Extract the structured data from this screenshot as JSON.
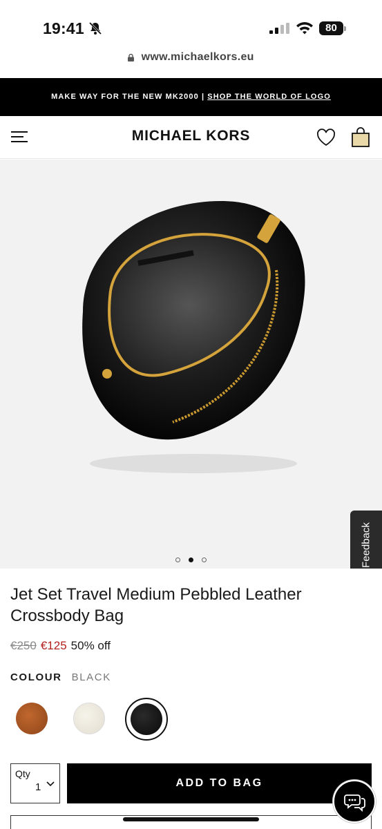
{
  "status_bar": {
    "time": "19:41",
    "battery": "80"
  },
  "browser": {
    "url": "www.michaelkors.eu"
  },
  "promo": {
    "text": "MAKE WAY FOR THE NEW MK2000 | ",
    "link": "SHOP THE WORLD OF LOGO"
  },
  "header": {
    "brand": "MICHAEL KORS"
  },
  "gallery": {
    "image_count": 3,
    "active_index": 1,
    "feedback_label": "Feedback"
  },
  "product": {
    "title": "Jet Set Travel Medium Pebbled Leather Crossbody Bag",
    "price_original": "€250",
    "price_sale": "€125",
    "discount": "50% off",
    "colour_label": "COLOUR",
    "colour_selected": "BLACK",
    "swatch_colors": [
      "#a4572a",
      "#efebe0",
      "#111111"
    ]
  },
  "purchase": {
    "qty_label": "Qty",
    "qty_value": "1",
    "add_to_bag": "ADD TO BAG"
  }
}
